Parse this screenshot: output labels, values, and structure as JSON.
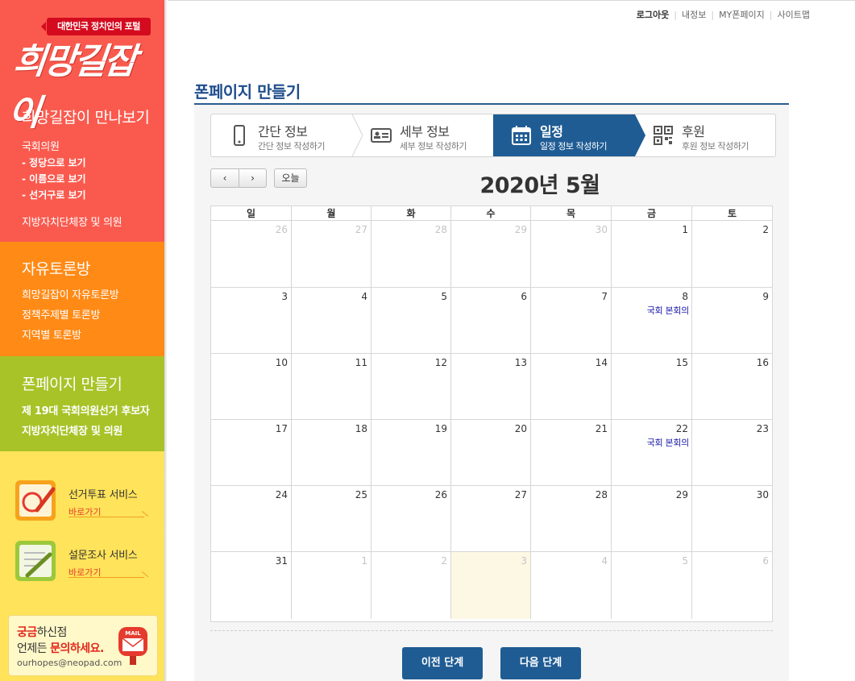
{
  "sidebar": {
    "logo_tag": "대한민국 정치인의 포털",
    "logo_text": "희망길잡이",
    "meet": {
      "title": "희망길잡이 만나보기",
      "assembly": "국회의원",
      "subs": [
        "-  정당으로 보기",
        "-  이름으로 보기",
        "-  선거구로 보기"
      ],
      "local": "지방자치단체장 및 의원"
    },
    "forum": {
      "title": "자유토론방",
      "items": [
        "희망길잡이 자유토론방",
        "정책주제별 토론방",
        "지역별 토론방"
      ]
    },
    "fanpage": {
      "title": "폰페이지 만들기",
      "items": [
        "제 19대 국회의원선거 후보자",
        "지방자치단체장 및 의원"
      ]
    },
    "services": [
      {
        "title": "선거투표 서비스",
        "go": "바로가기",
        "icon": "vote-icon"
      },
      {
        "title": "설문조사 서비스",
        "go": "바로가기",
        "icon": "survey-icon"
      }
    ],
    "contact": {
      "l1_red": "궁금",
      "l1_rest": "하신점",
      "l2_pre": "언제든 ",
      "l2_red": "문의하세요.",
      "email": "ourhopes@neopad.com",
      "mail_label": "MAIL"
    }
  },
  "toplinks": [
    "로그아웃",
    "내정보",
    "MY폰페이지",
    "사이트맵"
  ],
  "page_title": "폰페이지 만들기",
  "steps": [
    {
      "title": "간단 정보",
      "sub": "간단 정보 작성하기",
      "icon": "phone-icon",
      "active": false
    },
    {
      "title": "세부 정보",
      "sub": "세부 정보 작성하기",
      "icon": "id-card-icon",
      "active": false
    },
    {
      "title": "일정",
      "sub": "일정 정보 작성하기",
      "icon": "calendar-icon",
      "active": true
    },
    {
      "title": "후원",
      "sub": "후원 정보 작성하기",
      "icon": "qr-code-icon",
      "active": false
    }
  ],
  "calendar": {
    "prev": "‹",
    "next": "›",
    "today": "오늘",
    "title": "2020년 5월",
    "weekdays": [
      "일",
      "월",
      "화",
      "수",
      "목",
      "금",
      "토"
    ],
    "weeks": [
      [
        {
          "d": "26",
          "o": true
        },
        {
          "d": "27",
          "o": true
        },
        {
          "d": "28",
          "o": true
        },
        {
          "d": "29",
          "o": true
        },
        {
          "d": "30",
          "o": true
        },
        {
          "d": "1"
        },
        {
          "d": "2"
        }
      ],
      [
        {
          "d": "3"
        },
        {
          "d": "4"
        },
        {
          "d": "5"
        },
        {
          "d": "6"
        },
        {
          "d": "7"
        },
        {
          "d": "8",
          "e": "국회 본회의"
        },
        {
          "d": "9"
        }
      ],
      [
        {
          "d": "10"
        },
        {
          "d": "11"
        },
        {
          "d": "12"
        },
        {
          "d": "13"
        },
        {
          "d": "14"
        },
        {
          "d": "15"
        },
        {
          "d": "16"
        }
      ],
      [
        {
          "d": "17"
        },
        {
          "d": "18"
        },
        {
          "d": "19"
        },
        {
          "d": "20"
        },
        {
          "d": "21"
        },
        {
          "d": "22",
          "e": "국회 본회의"
        },
        {
          "d": "23"
        }
      ],
      [
        {
          "d": "24"
        },
        {
          "d": "25"
        },
        {
          "d": "26"
        },
        {
          "d": "27"
        },
        {
          "d": "28"
        },
        {
          "d": "29"
        },
        {
          "d": "30"
        }
      ],
      [
        {
          "d": "31"
        },
        {
          "d": "1",
          "o": true
        },
        {
          "d": "2",
          "o": true
        },
        {
          "d": "3",
          "o": true,
          "t": true
        },
        {
          "d": "4",
          "o": true
        },
        {
          "d": "5",
          "o": true
        },
        {
          "d": "6",
          "o": true
        }
      ]
    ]
  },
  "buttons": {
    "prev_step": "이전 단계",
    "next_step": "다음 단계"
  },
  "colors": {
    "accent": "#1f5c94",
    "red_block": "#fa5a4e",
    "orange_block": "#ff8a16",
    "green_block": "#a7c328",
    "yellow_block": "#ffe35a",
    "event": "#1a1aa8"
  }
}
